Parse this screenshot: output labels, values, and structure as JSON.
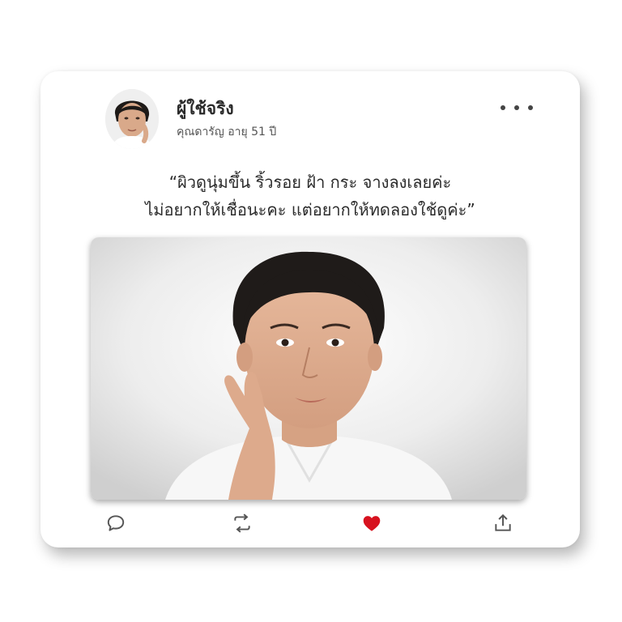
{
  "post": {
    "username": "ผู้ใช้จริง",
    "subtitle": "คุณดารัญ อายุ 51  ปี",
    "quote_line_1": "“ผิวดูนุ่มขึ้น ริ้วรอย ฝ้า กระ จางลงเลยค่ะ",
    "quote_line_2": "ไม่อยากให้เชื่อนะคะ แต่อยากให้ทดลองใช้ดูค่ะ”"
  },
  "icons": {
    "more": "more-horizontal-icon",
    "comment": "comment-icon",
    "repost": "repost-icon",
    "like": "heart-icon",
    "share": "share-icon"
  },
  "colors": {
    "like": "#d7121f",
    "icon": "#555555",
    "text": "#2b2b2b"
  }
}
